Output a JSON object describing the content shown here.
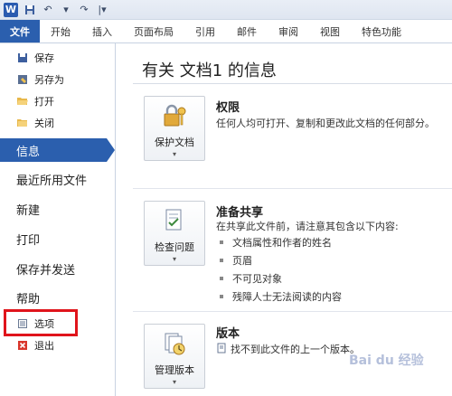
{
  "qat": {
    "app_logo": "W",
    "icons": [
      "save-icon",
      "undo-icon",
      "redo-icon",
      "customize-icon"
    ]
  },
  "tabs": [
    {
      "label": "文件"
    },
    {
      "label": "开始"
    },
    {
      "label": "插入"
    },
    {
      "label": "页面布局"
    },
    {
      "label": "引用"
    },
    {
      "label": "邮件"
    },
    {
      "label": "审阅"
    },
    {
      "label": "视图"
    },
    {
      "label": "特色功能"
    }
  ],
  "leftnav": {
    "save": "保存",
    "save_as": "另存为",
    "open": "打开",
    "close": "关闭",
    "info": "信息",
    "recent": "最近所用文件",
    "new": "新建",
    "print": "打印",
    "save_send": "保存并发送",
    "help": "帮助",
    "options": "选项",
    "exit": "退出"
  },
  "main": {
    "title": "有关 文档1 的信息",
    "permissions": {
      "button": "保护文档",
      "heading": "权限",
      "desc": "任何人均可打开、复制和更改此文档的任何部分。"
    },
    "share": {
      "button": "检查问题",
      "heading": "准备共享",
      "desc": "在共享此文件前，请注意其包含以下内容:",
      "items": [
        "文档属性和作者的姓名",
        "页眉",
        "不可见对象",
        "残障人士无法阅读的内容"
      ]
    },
    "versions": {
      "button": "管理版本",
      "heading": "版本",
      "desc": "找不到此文件的上一个版本。"
    }
  },
  "watermark": "Bai du 经验",
  "colors": {
    "accent": "#2b5fae",
    "highlight": "#e0141b"
  }
}
